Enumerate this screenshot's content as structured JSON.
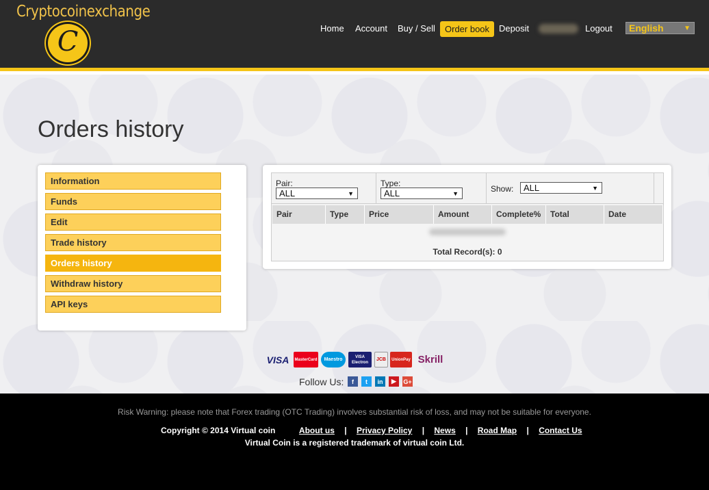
{
  "brand": {
    "name": "Cryptocoinexchange",
    "logo_letter": "C"
  },
  "nav": {
    "items": [
      {
        "label": "Home"
      },
      {
        "label": "Account"
      },
      {
        "label": "Buy / Sell"
      },
      {
        "label": "Order book"
      },
      {
        "label": "Deposit"
      },
      {
        "label": "Logout"
      }
    ],
    "language": "English"
  },
  "page": {
    "title": "Orders history"
  },
  "sidebar": {
    "items": [
      {
        "label": "Information"
      },
      {
        "label": "Funds"
      },
      {
        "label": "Edit"
      },
      {
        "label": "Trade history"
      },
      {
        "label": "Orders history"
      },
      {
        "label": "Withdraw history"
      },
      {
        "label": "API keys"
      }
    ]
  },
  "filters": {
    "pair": {
      "label": "Pair:",
      "value": "ALL"
    },
    "type": {
      "label": "Type:",
      "value": "ALL"
    },
    "show": {
      "label": "Show:",
      "value": "ALL"
    }
  },
  "table": {
    "headers": [
      "Pair",
      "Type",
      "Price",
      "Amount",
      "Complete%",
      "Total",
      "Date"
    ],
    "total_records": "Total Record(s): 0"
  },
  "payments": [
    "VISA",
    "MasterCard",
    "Maestro",
    "VISA Electron",
    "JCB",
    "UnionPay",
    "Skrill"
  ],
  "follow": {
    "label": "Follow Us:",
    "networks": [
      {
        "name": "facebook",
        "glyph": "f",
        "color": "#3b5998"
      },
      {
        "name": "twitter",
        "glyph": "t",
        "color": "#1da1f2"
      },
      {
        "name": "linkedin",
        "glyph": "in",
        "color": "#0077b5"
      },
      {
        "name": "youtube",
        "glyph": "▶",
        "color": "#cc181e"
      },
      {
        "name": "google-plus",
        "glyph": "G+",
        "color": "#dd4b39"
      }
    ]
  },
  "footer": {
    "risk_warning": "Risk Warning: please note that Forex trading (OTC Trading) involves substantial risk of loss, and may not be suitable for everyone.",
    "copyright": "Copyright © 2014 Virtual coin",
    "links": [
      "About us",
      "Privacy Policy",
      "News",
      "Road Map",
      "Contact Us"
    ],
    "trademark": "Virtual Coin is a registered trademark of virtual coin Ltd."
  },
  "colors": {
    "accent": "#f5c518",
    "header_bg": "#2b2b2b",
    "sidebar_item": "#fdd05a",
    "sidebar_active": "#f5b50f"
  }
}
